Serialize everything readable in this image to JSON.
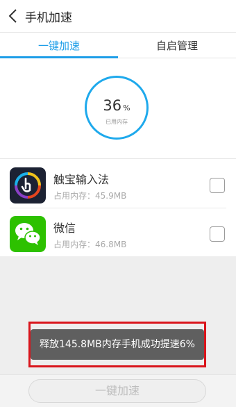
{
  "header": {
    "title": "手机加速"
  },
  "tabs": [
    {
      "label": "一键加速",
      "active": true
    },
    {
      "label": "自启管理",
      "active": false
    }
  ],
  "memory": {
    "percent": "36",
    "unit": "%",
    "label": "已用内存",
    "level_fraction": 0.36
  },
  "apps": [
    {
      "name": "触宝输入法",
      "memory": "占用内存：45.9MB",
      "checked": false,
      "icon": "touchpal-keyboard-icon"
    },
    {
      "name": "微信",
      "memory": "占用内存：46.8MB",
      "checked": false,
      "icon": "wechat-icon"
    }
  ],
  "toast": {
    "text": "释放145.8MB内存手机成功提速6%"
  },
  "bottom": {
    "button_label": "一键加速"
  },
  "colors": {
    "accent": "#1e9ee8",
    "highlight_box": "#d9141b",
    "wechat_green": "#2dc100"
  }
}
